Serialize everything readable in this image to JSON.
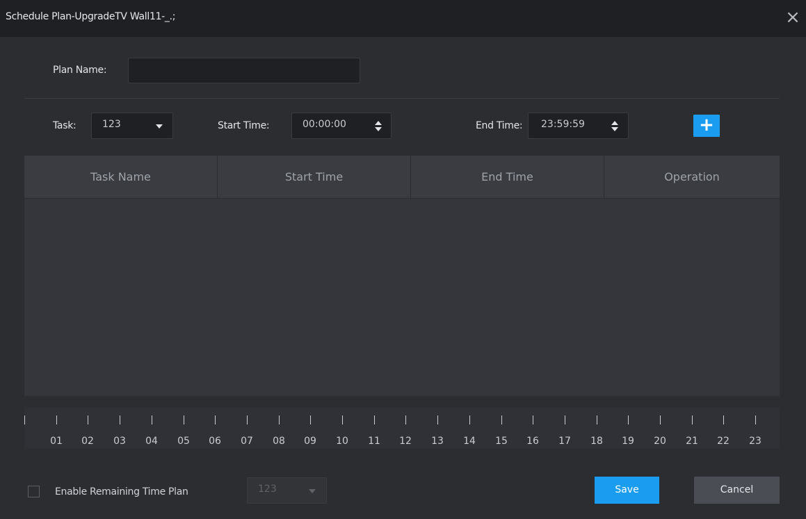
{
  "window": {
    "title": "Schedule Plan-UpgradeTV Wall11-_.;",
    "close_icon": "×"
  },
  "plan": {
    "name_label": "Plan Name:",
    "name_value": ""
  },
  "task_row": {
    "task_label": "Task:",
    "task_value": "123",
    "start_label": "Start Time:",
    "start_value": "00:00:00",
    "end_label": "End Time:",
    "end_value": "23:59:59",
    "add_label": "+"
  },
  "table": {
    "columns": [
      "Task Name",
      "Start Time",
      "End Time",
      "Operation"
    ],
    "rows": []
  },
  "timeline": {
    "hours": [
      "01",
      "02",
      "03",
      "04",
      "05",
      "06",
      "07",
      "08",
      "09",
      "10",
      "11",
      "12",
      "13",
      "14",
      "15",
      "16",
      "17",
      "18",
      "19",
      "20",
      "21",
      "22",
      "23"
    ]
  },
  "footer": {
    "enable_label": "Enable Remaining Time Plan",
    "enable_checked": false,
    "remaining_value": "123",
    "save_label": "Save",
    "cancel_label": "Cancel"
  },
  "colors": {
    "accent": "#1a9cf0",
    "background": "#2b2d31",
    "titlebar": "#1f2023"
  }
}
